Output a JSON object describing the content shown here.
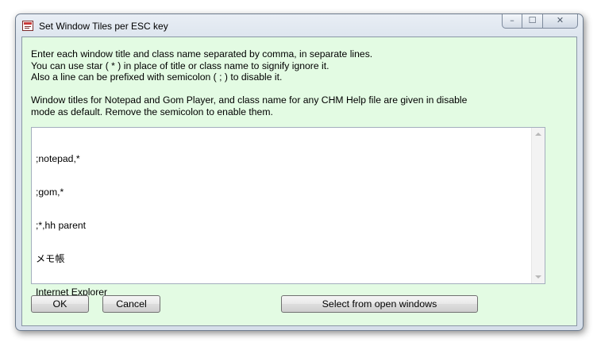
{
  "window": {
    "title": "Set Window Tiles per ESC key",
    "icon": "app-icon",
    "controls": {
      "minimize_glyph": "–",
      "maximize_glyph": "☐",
      "close_glyph": "✕"
    }
  },
  "description": {
    "lines": [
      "Enter each window title and class name separated by comma, in separate lines.",
      "You can use star ( * ) in place of title or class name to signify ignore it.",
      "Also a line can be prefixed with semicolon ( ; ) to disable it.",
      "",
      "Window titles for Notepad and Gom Player, and class name for any CHM Help file are given in disable",
      "mode as default. Remove the semicolon to enable them."
    ]
  },
  "editor": {
    "lines": [
      ";notepad,*",
      ";gom,*",
      ";*,hh parent",
      "メモ帳",
      "Internet Explorer"
    ]
  },
  "buttons": {
    "ok": "OK",
    "cancel": "Cancel",
    "select": "Select from open windows"
  },
  "colors": {
    "client_background": "#e3fbe3",
    "window_frame": "#d6dfea"
  }
}
